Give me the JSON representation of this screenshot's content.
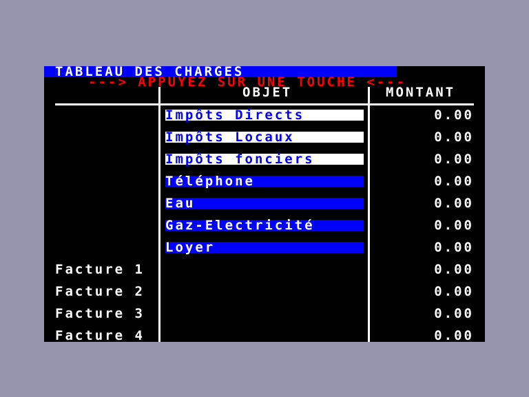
{
  "title": "TABLEAU DES CHARGES",
  "prompt": "---> APPUYEZ SUR UNE TOUCHE <---",
  "columns": {
    "objet": "OBJET",
    "montant": "MONTANT"
  },
  "colors": {
    "title_bg": "#0000ff",
    "prompt": "#ff0000",
    "highlight_blue": "#0000ff",
    "highlight_white": "#ffffff",
    "background": "#000000"
  },
  "rows": [
    {
      "label": "",
      "objet": "Impôts Directs",
      "montant": "0.00",
      "style": "white"
    },
    {
      "label": "",
      "objet": "Impôts Locaux",
      "montant": "0.00",
      "style": "white"
    },
    {
      "label": "",
      "objet": "Impôts fonciers",
      "montant": "0.00",
      "style": "white"
    },
    {
      "label": "",
      "objet": "Téléphone",
      "montant": "0.00",
      "style": "blue"
    },
    {
      "label": "",
      "objet": "Eau",
      "montant": "0.00",
      "style": "blue"
    },
    {
      "label": "",
      "objet": "Gaz-Electricité",
      "montant": "0.00",
      "style": "blue"
    },
    {
      "label": "",
      "objet": "Loyer",
      "montant": "0.00",
      "style": "blue"
    },
    {
      "label": "Facture 1",
      "objet": "",
      "montant": "0.00",
      "style": "none"
    },
    {
      "label": "Facture 2",
      "objet": "",
      "montant": "0.00",
      "style": "none"
    },
    {
      "label": "Facture 3",
      "objet": "",
      "montant": "0.00",
      "style": "none"
    },
    {
      "label": "Facture 4",
      "objet": "",
      "montant": "0.00",
      "style": "none"
    }
  ]
}
